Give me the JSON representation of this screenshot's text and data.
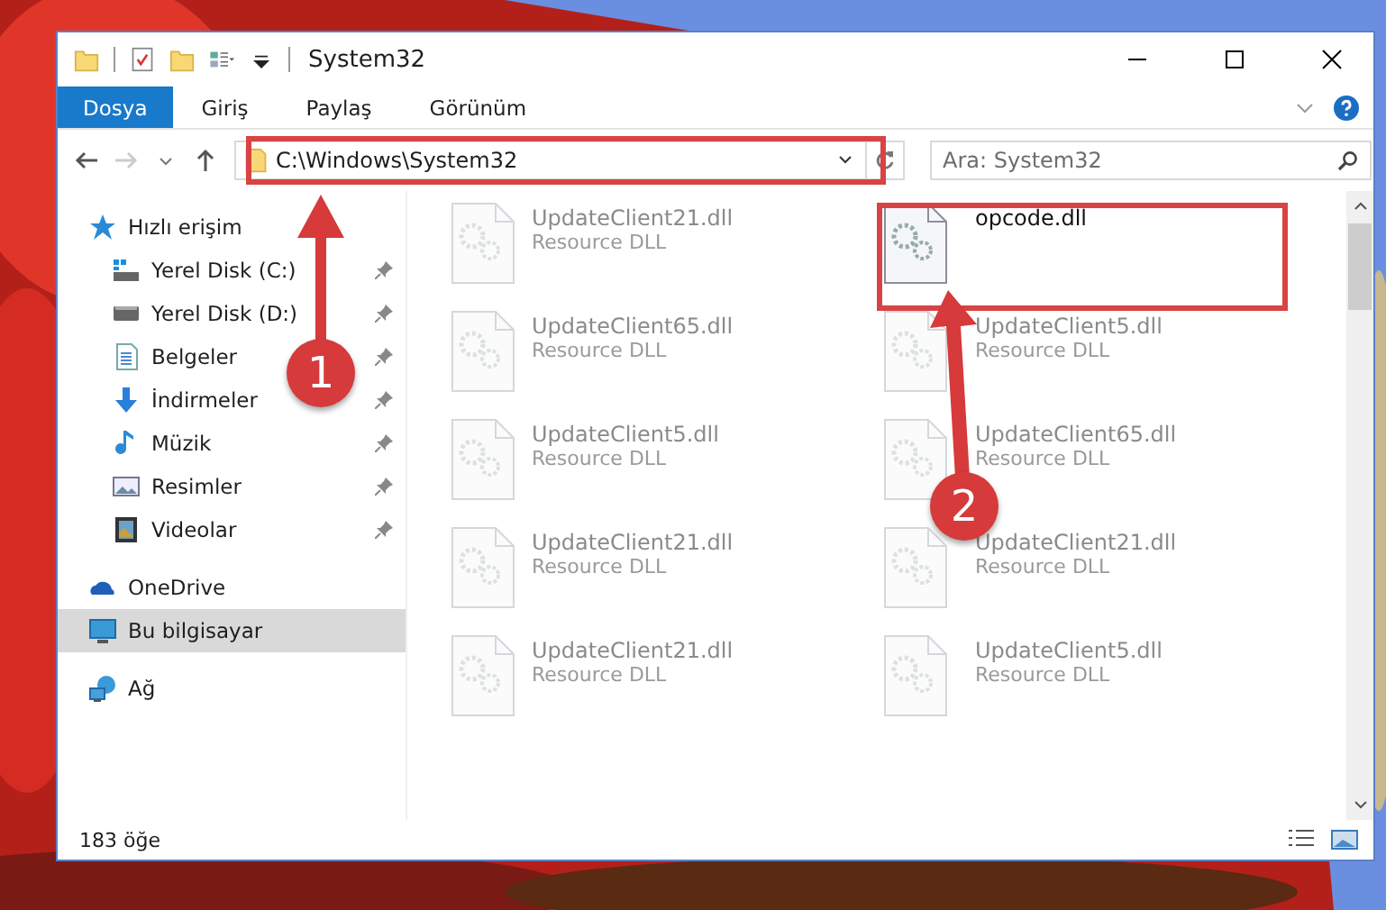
{
  "window": {
    "title": "System32"
  },
  "ribbon_tabs": [
    {
      "label": "Dosya",
      "selected": true
    },
    {
      "label": "Giriş",
      "selected": false
    },
    {
      "label": "Paylaş",
      "selected": false
    },
    {
      "label": "Görünüm",
      "selected": false
    }
  ],
  "address_bar": {
    "value": "C:\\Windows\\System32"
  },
  "search": {
    "placeholder": "Ara: System32"
  },
  "sidebar": {
    "items": [
      {
        "label": "Hızlı erişim",
        "kind": "star",
        "selected": false,
        "children": [
          {
            "label": "Yerel Disk (C:)",
            "kind": "system-drive",
            "pinned": true,
            "selected": false
          },
          {
            "label": "Yerel Disk (D:)",
            "kind": "drive",
            "pinned": true,
            "selected": false
          },
          {
            "label": "Belgeler",
            "kind": "documents",
            "pinned": true,
            "selected": false
          },
          {
            "label": "İndirmeler",
            "kind": "downloads",
            "pinned": true,
            "selected": false
          },
          {
            "label": "Müzik",
            "kind": "music",
            "pinned": true,
            "selected": false
          },
          {
            "label": "Resimler",
            "kind": "pictures",
            "pinned": true,
            "selected": false
          },
          {
            "label": "Videolar",
            "kind": "videos",
            "pinned": true,
            "selected": false
          }
        ]
      },
      {
        "label": "OneDrive",
        "kind": "cloud",
        "selected": false
      },
      {
        "label": "Bu bilgisayar",
        "kind": "computer",
        "selected": true
      },
      {
        "label": "Ağ",
        "kind": "network",
        "selected": false
      }
    ]
  },
  "files": [
    {
      "name": "UpdateClient21.dll",
      "type": "Resource DLL",
      "blurred": true
    },
    {
      "name": "opcode.dll",
      "blurred": false
    },
    {
      "name": "UpdateClient65.dll",
      "type": "Resource DLL",
      "blurred": true
    },
    {
      "name": "UpdateClient5.dll",
      "type": "Resource DLL",
      "blurred": true
    },
    {
      "name": "UpdateClient5.dll",
      "type": "Resource DLL",
      "blurred": true
    },
    {
      "name": "UpdateClient65.dll",
      "type": "Resource DLL",
      "blurred": true
    },
    {
      "name": "UpdateClient21.dll",
      "type": "Resource DLL",
      "blurred": true
    },
    {
      "name": "UpdateClient21.dll",
      "type": "Resource DLL",
      "blurred": true
    },
    {
      "name": "UpdateClient21.dll",
      "type": "Resource DLL",
      "blurred": true
    },
    {
      "name": "UpdateClient5.dll",
      "type": "Resource DLL",
      "blurred": true
    }
  ],
  "status_bar": {
    "item_count": "183 öğe"
  },
  "annotations": [
    {
      "label": "1"
    },
    {
      "label": "2"
    }
  ]
}
